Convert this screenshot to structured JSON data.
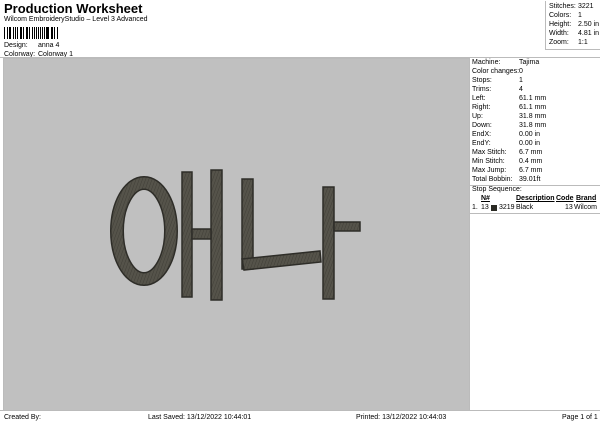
{
  "header": {
    "title": "Production Worksheet",
    "subtitle": "Wilcom EmbroideryStudio – Level 3 Advanced",
    "design_label": "Design:",
    "design_value": "anna 4",
    "colorway_label": "Colorway:",
    "colorway_value": "Colorway 1"
  },
  "summary": [
    {
      "label": "Stitches:",
      "value": "3221"
    },
    {
      "label": "Colors:",
      "value": "1"
    },
    {
      "label": "Height:",
      "value": "2.50 in"
    },
    {
      "label": "Width:",
      "value": "4.81 in"
    },
    {
      "label": "Zoom:",
      "value": "1:1"
    }
  ],
  "properties": [
    {
      "label": "Machine:",
      "value": "Tajima"
    },
    {
      "label": "Color changes:",
      "value": "0"
    },
    {
      "label": "Stops:",
      "value": "1"
    },
    {
      "label": "Trims:",
      "value": "4"
    },
    {
      "label": "Left:",
      "value": "61.1 mm"
    },
    {
      "label": "Right:",
      "value": "61.1 mm"
    },
    {
      "label": "Up:",
      "value": "31.8 mm"
    },
    {
      "label": "Down:",
      "value": "31.8 mm"
    },
    {
      "label": "EndX:",
      "value": "0.00 in"
    },
    {
      "label": "EndY:",
      "value": "0.00 in"
    },
    {
      "label": "Max Stitch:",
      "value": "6.7 mm"
    },
    {
      "label": "Min Stitch:",
      "value": "0.4 mm"
    },
    {
      "label": "Max Jump:",
      "value": "6.7 mm"
    },
    {
      "label": "Total Bobbin:",
      "value": "39.01ft"
    }
  ],
  "stop_sequence": {
    "title": "Stop Sequence:",
    "headers": {
      "n": "N#",
      "desc": "Description",
      "code": "Code",
      "brand": "Brand"
    },
    "row": {
      "idx": "1.",
      "n": "13",
      "swatch": "#2a2a24",
      "stitches": "3219",
      "desc": "Black",
      "code": "13",
      "brand": "Wilcom"
    }
  },
  "colors": {
    "thread": "#55534a",
    "thread_dark": "#2e2d28",
    "canvas_bg": "#c0c0c0"
  },
  "footer": {
    "created_by": "Created By:",
    "last_saved": "Last Saved: 13/12/2022 10:44:01",
    "printed": "Printed: 13/12/2022 10:44:03",
    "page": "Page 1 of 1"
  }
}
